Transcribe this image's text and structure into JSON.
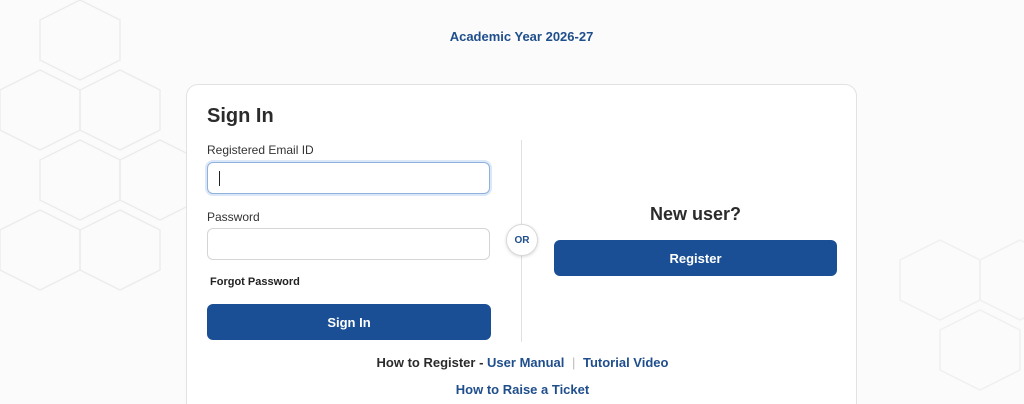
{
  "header": {
    "academic_year": "Academic Year 2026-27"
  },
  "signin": {
    "title": "Sign In",
    "email_label": "Registered Email ID",
    "email_value": "",
    "password_label": "Password",
    "password_value": "",
    "forgot_label": "Forgot Password",
    "button_label": "Sign In"
  },
  "divider": {
    "or_label": "OR"
  },
  "new_user": {
    "heading": "New user?",
    "register_label": "Register"
  },
  "help": {
    "how_to_register": "How to Register -",
    "user_manual": "User Manual",
    "separator": "|",
    "tutorial_video": "Tutorial Video",
    "raise_ticket": "How to Raise a Ticket"
  },
  "colors": {
    "accent": "#1a4f96",
    "link": "#1f4e8c"
  }
}
